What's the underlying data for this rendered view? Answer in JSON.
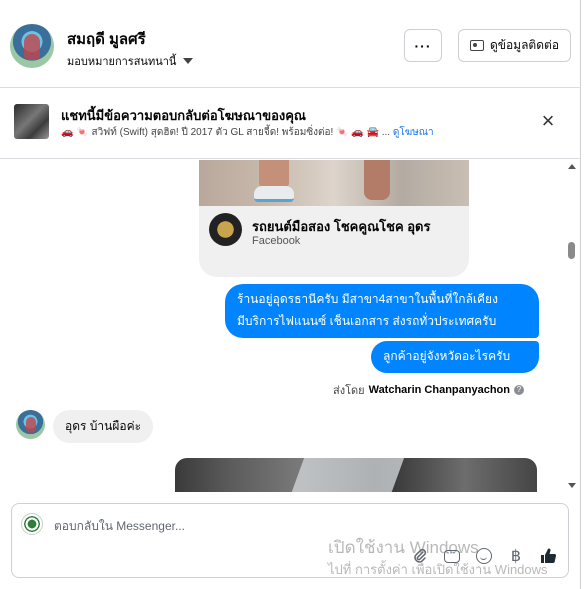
{
  "header": {
    "contact_name": "สมฤดี มูลศรี",
    "assign_label": "มอบหมายการสนทนานี้",
    "more_label": "···",
    "view_contact_label": "ดูข้อมูลติดต่อ"
  },
  "ad_banner": {
    "title": "แชทนี้มีข้อความตอบกลับต่อโฆษณาของคุณ",
    "subtitle": "🚗 🍬 สวิฟท์ (Swift) สุดฮิต! ปี 2017 ตัว GL สายจี้ด! พร้อมซิ่งต่อ! 🍬 🚗 🚘 ...",
    "link_label": "ดูโฆษณา",
    "close_symbol": "×"
  },
  "messages": {
    "link_card": {
      "title": "รถยนต์มือสอง โชคคูณโชค อุดร",
      "source": "Facebook"
    },
    "outgoing": [
      {
        "line1": "ร้านอยู่อุดรธานีครับ มีสาขา4สาขาในพื้นที่ใกล้เคียง",
        "line2": "มีบริการไฟแนนซ์ เช็นเอกสาร ส่งรถทั่วประเทศครับ"
      },
      {
        "line1": "ลูกค้าอยู่จังหวัดอะไรครับ"
      }
    ],
    "sent_by_prefix": "ส่งโดย",
    "sent_by_name": "Watcharin Chanpanyachon",
    "incoming": [
      {
        "text": "อุดร บ้านผือค่ะ"
      }
    ]
  },
  "composer": {
    "placeholder": "ตอบกลับใน Messenger...",
    "watermark_line1": "เปิดใช้งาน Windows",
    "watermark_line2": "ไปที่ การตั้งค่า เพื่อเปิดใช้งาน Windows",
    "currency_symbol": "฿"
  },
  "icons": {
    "caret": "caret-down-icon",
    "contact_card": "contact-card-icon",
    "close": "close-icon",
    "attach": "paperclip-icon",
    "chat": "chat-bubble-icon",
    "emoji": "emoji-icon",
    "payment": "baht-icon",
    "like": "thumbs-up-icon"
  },
  "colors": {
    "outgoing_bubble": "#0084ff",
    "incoming_bubble": "#f0f0f0",
    "link": "#1b74e4"
  }
}
